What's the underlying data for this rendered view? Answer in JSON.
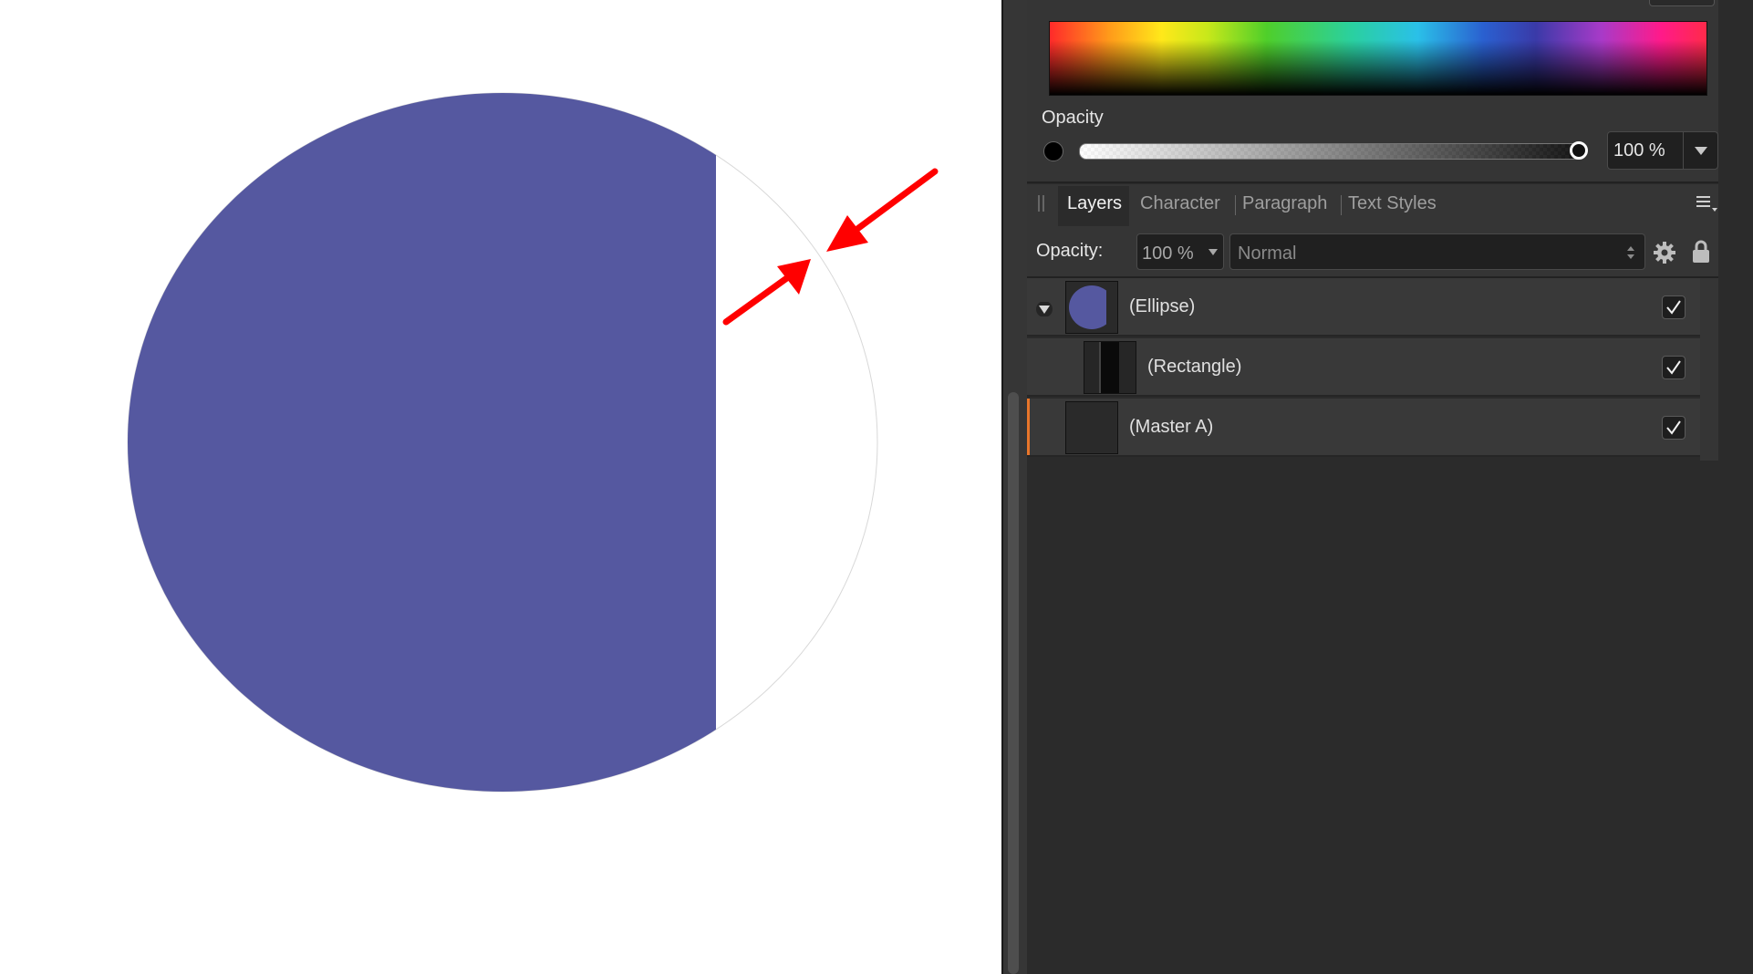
{
  "colors": {
    "ellipse_fill": "#5558a0",
    "annotation_arrow": "#ff0000",
    "panel_bg": "#2b2b2b",
    "master_marker": "#e8762a"
  },
  "color_panel": {
    "opacity_label": "Opacity",
    "opacity_value": "100 %",
    "opacity_level": 1.0
  },
  "tabs": [
    {
      "label": "Layers",
      "active": true
    },
    {
      "label": "Character",
      "active": false
    },
    {
      "label": "Paragraph",
      "active": false
    },
    {
      "label": "Text Styles",
      "active": false
    }
  ],
  "layer_controls": {
    "opacity_label": "Opacity:",
    "opacity_value": "100 %",
    "blend_mode": "Normal"
  },
  "layers": [
    {
      "name": "(Ellipse)",
      "visible": true,
      "expanded": true
    },
    {
      "name": "(Rectangle)",
      "visible": true
    },
    {
      "name": "(Master A)",
      "visible": true
    }
  ],
  "icons": [
    "drop-arrow-icon",
    "panel-menu-icon",
    "gear-icon",
    "lock-icon",
    "disclosure-triangle-icon",
    "checkmark-icon"
  ]
}
